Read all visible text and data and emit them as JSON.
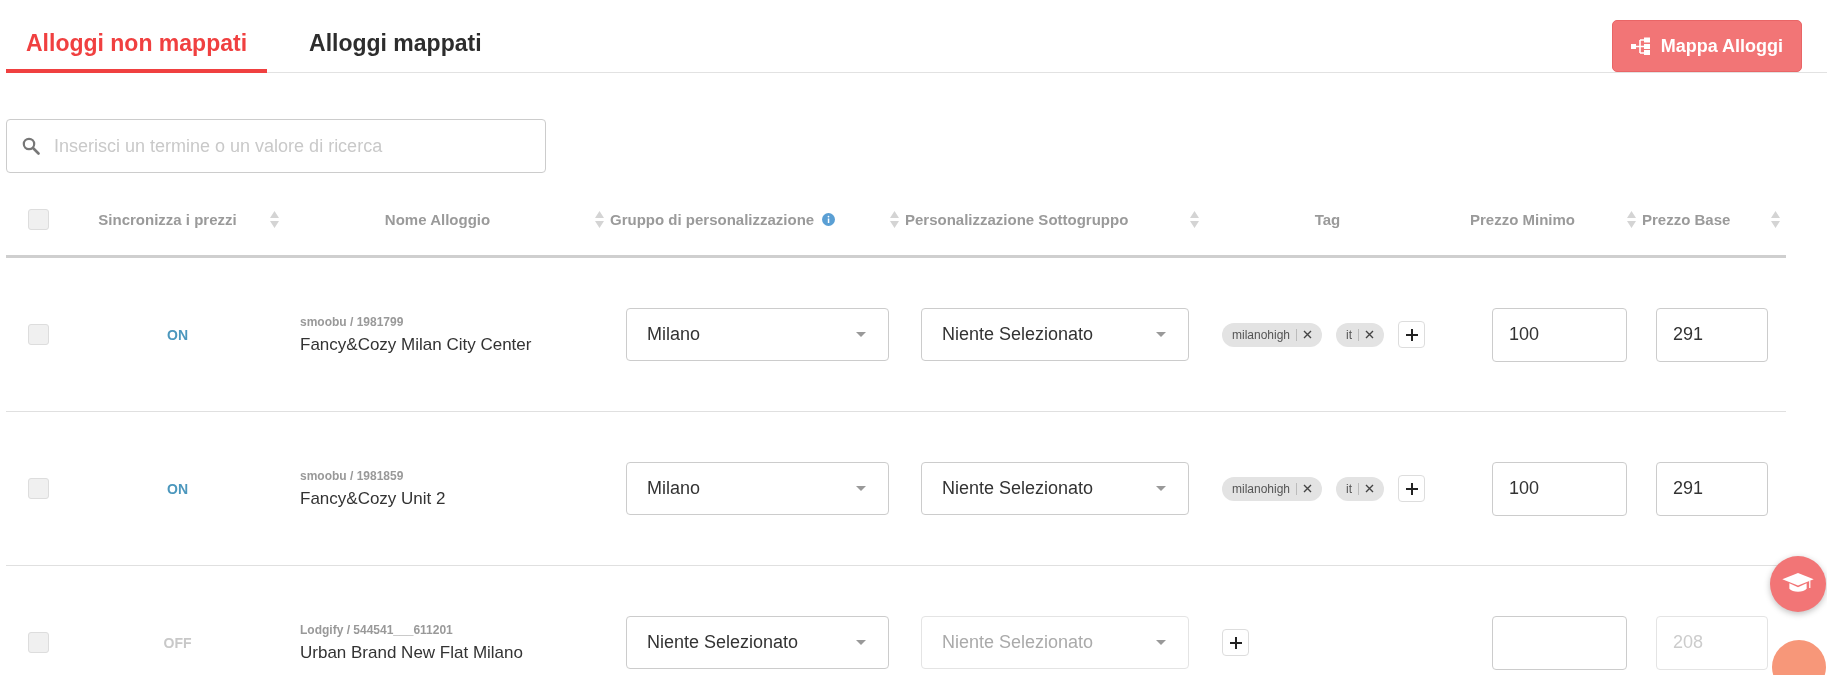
{
  "tabs": [
    {
      "label": "Alloggi non mappati",
      "selected": true
    },
    {
      "label": "Alloggi mappati",
      "selected": false
    }
  ],
  "map_button": {
    "label": "Mappa Alloggi"
  },
  "search": {
    "placeholder": "Inserisci un termine o un valore di ricerca"
  },
  "table": {
    "select_all": {
      "checked": false
    },
    "columns": [
      {
        "label": "Sincronizza i prezzi",
        "sortable": true,
        "info": false
      },
      {
        "label": "Nome Alloggio",
        "sortable": true,
        "info": false
      },
      {
        "label": "Gruppo di personalizzazione",
        "sortable": true,
        "info": true
      },
      {
        "label": "Personalizzazione Sottogruppo",
        "sortable": true,
        "info": false
      },
      {
        "label": "Tag",
        "sortable": false,
        "info": false
      },
      {
        "label": "Prezzo Minimo",
        "sortable": true,
        "info": false
      },
      {
        "label": "Prezzo Base",
        "sortable": true,
        "info": false
      }
    ],
    "rows": [
      {
        "checked": false,
        "sync": {
          "label": "ON",
          "on": true
        },
        "source": "smoobu / 1981799",
        "name": "Fancy&Cozy Milan City Center",
        "group": {
          "value": "Milano",
          "disabled": false
        },
        "subgroup": {
          "value": "Niente Selezionato",
          "disabled": false
        },
        "tags": [
          "milanohigh",
          "it"
        ],
        "min_price": {
          "value": "100",
          "disabled": false
        },
        "base_price": {
          "value": "291",
          "disabled": false
        }
      },
      {
        "checked": false,
        "sync": {
          "label": "ON",
          "on": true
        },
        "source": "smoobu / 1981859",
        "name": "Fancy&Cozy Unit 2",
        "group": {
          "value": "Milano",
          "disabled": false
        },
        "subgroup": {
          "value": "Niente Selezionato",
          "disabled": false
        },
        "tags": [
          "milanohigh",
          "it"
        ],
        "min_price": {
          "value": "100",
          "disabled": false
        },
        "base_price": {
          "value": "291",
          "disabled": false
        }
      },
      {
        "checked": false,
        "sync": {
          "label": "OFF",
          "on": false
        },
        "source": "Lodgify / 544541___611201",
        "name": "Urban Brand New Flat Milano",
        "group": {
          "value": "Niente Selezionato",
          "disabled": false
        },
        "subgroup": {
          "value": "Niente Selezionato",
          "disabled": true
        },
        "tags": [],
        "min_price": {
          "disabled": false
        },
        "base_price": {
          "placeholder": "208",
          "disabled": true
        }
      }
    ]
  }
}
